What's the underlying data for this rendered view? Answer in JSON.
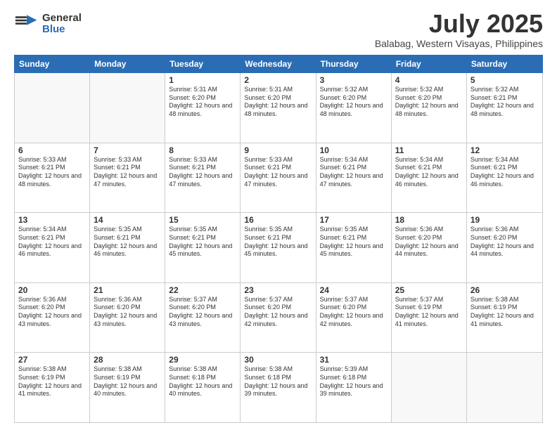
{
  "logo": {
    "general": "General",
    "blue": "Blue"
  },
  "title": {
    "month": "July 2025",
    "location": "Balabag, Western Visayas, Philippines"
  },
  "days": [
    "Sunday",
    "Monday",
    "Tuesday",
    "Wednesday",
    "Thursday",
    "Friday",
    "Saturday"
  ],
  "weeks": [
    [
      {
        "day": "",
        "empty": true
      },
      {
        "day": "",
        "empty": true
      },
      {
        "day": "1",
        "sunrise": "Sunrise: 5:31 AM",
        "sunset": "Sunset: 6:20 PM",
        "daylight": "Daylight: 12 hours and 48 minutes."
      },
      {
        "day": "2",
        "sunrise": "Sunrise: 5:31 AM",
        "sunset": "Sunset: 6:20 PM",
        "daylight": "Daylight: 12 hours and 48 minutes."
      },
      {
        "day": "3",
        "sunrise": "Sunrise: 5:32 AM",
        "sunset": "Sunset: 6:20 PM",
        "daylight": "Daylight: 12 hours and 48 minutes."
      },
      {
        "day": "4",
        "sunrise": "Sunrise: 5:32 AM",
        "sunset": "Sunset: 6:20 PM",
        "daylight": "Daylight: 12 hours and 48 minutes."
      },
      {
        "day": "5",
        "sunrise": "Sunrise: 5:32 AM",
        "sunset": "Sunset: 6:21 PM",
        "daylight": "Daylight: 12 hours and 48 minutes."
      }
    ],
    [
      {
        "day": "6",
        "sunrise": "Sunrise: 5:33 AM",
        "sunset": "Sunset: 6:21 PM",
        "daylight": "Daylight: 12 hours and 48 minutes."
      },
      {
        "day": "7",
        "sunrise": "Sunrise: 5:33 AM",
        "sunset": "Sunset: 6:21 PM",
        "daylight": "Daylight: 12 hours and 47 minutes."
      },
      {
        "day": "8",
        "sunrise": "Sunrise: 5:33 AM",
        "sunset": "Sunset: 6:21 PM",
        "daylight": "Daylight: 12 hours and 47 minutes."
      },
      {
        "day": "9",
        "sunrise": "Sunrise: 5:33 AM",
        "sunset": "Sunset: 6:21 PM",
        "daylight": "Daylight: 12 hours and 47 minutes."
      },
      {
        "day": "10",
        "sunrise": "Sunrise: 5:34 AM",
        "sunset": "Sunset: 6:21 PM",
        "daylight": "Daylight: 12 hours and 47 minutes."
      },
      {
        "day": "11",
        "sunrise": "Sunrise: 5:34 AM",
        "sunset": "Sunset: 6:21 PM",
        "daylight": "Daylight: 12 hours and 46 minutes."
      },
      {
        "day": "12",
        "sunrise": "Sunrise: 5:34 AM",
        "sunset": "Sunset: 6:21 PM",
        "daylight": "Daylight: 12 hours and 46 minutes."
      }
    ],
    [
      {
        "day": "13",
        "sunrise": "Sunrise: 5:34 AM",
        "sunset": "Sunset: 6:21 PM",
        "daylight": "Daylight: 12 hours and 46 minutes."
      },
      {
        "day": "14",
        "sunrise": "Sunrise: 5:35 AM",
        "sunset": "Sunset: 6:21 PM",
        "daylight": "Daylight: 12 hours and 46 minutes."
      },
      {
        "day": "15",
        "sunrise": "Sunrise: 5:35 AM",
        "sunset": "Sunset: 6:21 PM",
        "daylight": "Daylight: 12 hours and 45 minutes."
      },
      {
        "day": "16",
        "sunrise": "Sunrise: 5:35 AM",
        "sunset": "Sunset: 6:21 PM",
        "daylight": "Daylight: 12 hours and 45 minutes."
      },
      {
        "day": "17",
        "sunrise": "Sunrise: 5:35 AM",
        "sunset": "Sunset: 6:21 PM",
        "daylight": "Daylight: 12 hours and 45 minutes."
      },
      {
        "day": "18",
        "sunrise": "Sunrise: 5:36 AM",
        "sunset": "Sunset: 6:20 PM",
        "daylight": "Daylight: 12 hours and 44 minutes."
      },
      {
        "day": "19",
        "sunrise": "Sunrise: 5:36 AM",
        "sunset": "Sunset: 6:20 PM",
        "daylight": "Daylight: 12 hours and 44 minutes."
      }
    ],
    [
      {
        "day": "20",
        "sunrise": "Sunrise: 5:36 AM",
        "sunset": "Sunset: 6:20 PM",
        "daylight": "Daylight: 12 hours and 43 minutes."
      },
      {
        "day": "21",
        "sunrise": "Sunrise: 5:36 AM",
        "sunset": "Sunset: 6:20 PM",
        "daylight": "Daylight: 12 hours and 43 minutes."
      },
      {
        "day": "22",
        "sunrise": "Sunrise: 5:37 AM",
        "sunset": "Sunset: 6:20 PM",
        "daylight": "Daylight: 12 hours and 43 minutes."
      },
      {
        "day": "23",
        "sunrise": "Sunrise: 5:37 AM",
        "sunset": "Sunset: 6:20 PM",
        "daylight": "Daylight: 12 hours and 42 minutes."
      },
      {
        "day": "24",
        "sunrise": "Sunrise: 5:37 AM",
        "sunset": "Sunset: 6:20 PM",
        "daylight": "Daylight: 12 hours and 42 minutes."
      },
      {
        "day": "25",
        "sunrise": "Sunrise: 5:37 AM",
        "sunset": "Sunset: 6:19 PM",
        "daylight": "Daylight: 12 hours and 41 minutes."
      },
      {
        "day": "26",
        "sunrise": "Sunrise: 5:38 AM",
        "sunset": "Sunset: 6:19 PM",
        "daylight": "Daylight: 12 hours and 41 minutes."
      }
    ],
    [
      {
        "day": "27",
        "sunrise": "Sunrise: 5:38 AM",
        "sunset": "Sunset: 6:19 PM",
        "daylight": "Daylight: 12 hours and 41 minutes."
      },
      {
        "day": "28",
        "sunrise": "Sunrise: 5:38 AM",
        "sunset": "Sunset: 6:19 PM",
        "daylight": "Daylight: 12 hours and 40 minutes."
      },
      {
        "day": "29",
        "sunrise": "Sunrise: 5:38 AM",
        "sunset": "Sunset: 6:18 PM",
        "daylight": "Daylight: 12 hours and 40 minutes."
      },
      {
        "day": "30",
        "sunrise": "Sunrise: 5:38 AM",
        "sunset": "Sunset: 6:18 PM",
        "daylight": "Daylight: 12 hours and 39 minutes."
      },
      {
        "day": "31",
        "sunrise": "Sunrise: 5:39 AM",
        "sunset": "Sunset: 6:18 PM",
        "daylight": "Daylight: 12 hours and 39 minutes."
      },
      {
        "day": "",
        "empty": true
      },
      {
        "day": "",
        "empty": true
      }
    ]
  ]
}
